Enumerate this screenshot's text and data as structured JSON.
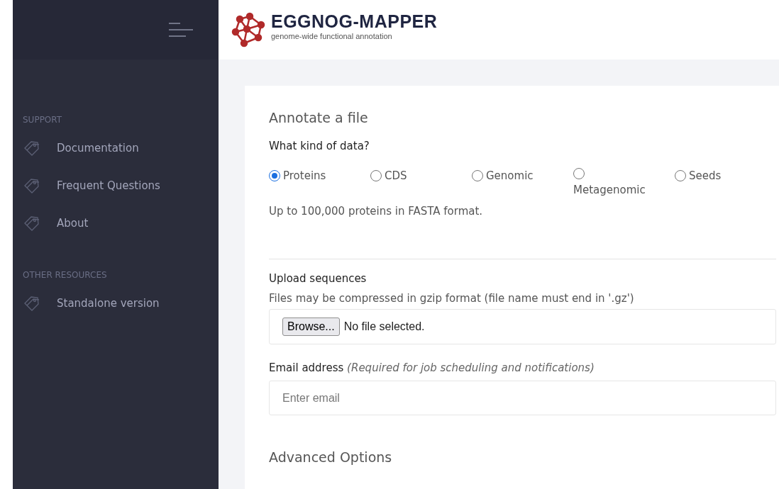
{
  "sidebar": {
    "sections": [
      {
        "heading": "SUPPORT",
        "items": [
          {
            "label": "Documentation"
          },
          {
            "label": "Frequent Questions"
          },
          {
            "label": "About"
          }
        ]
      },
      {
        "heading": "OTHER RESOURCES",
        "items": [
          {
            "label": "Standalone version"
          }
        ]
      }
    ]
  },
  "header": {
    "logo_title": "EGGNOG-MAPPER",
    "logo_subtitle": "genome-wide functional annotation"
  },
  "form": {
    "title": "Annotate a file",
    "data_kind_label": "What kind of data?",
    "options": [
      {
        "label": "Proteins",
        "selected": true
      },
      {
        "label": "CDS",
        "selected": false
      },
      {
        "label": "Genomic",
        "selected": false
      },
      {
        "label": "Metagenomic",
        "selected": false
      },
      {
        "label": "Seeds",
        "selected": false
      }
    ],
    "hint": "Up to 100,000 proteins in FASTA format.",
    "upload_label": "Upload sequences",
    "upload_note": "Files may be compressed in gzip format (file name must end in '.gz')",
    "browse_button": "Browse...",
    "file_status": "No file selected.",
    "email_label": "Email address",
    "email_note": "(Required for job scheduling and notifications)",
    "email_placeholder": "Enter email",
    "advanced_title": "Advanced Options"
  }
}
